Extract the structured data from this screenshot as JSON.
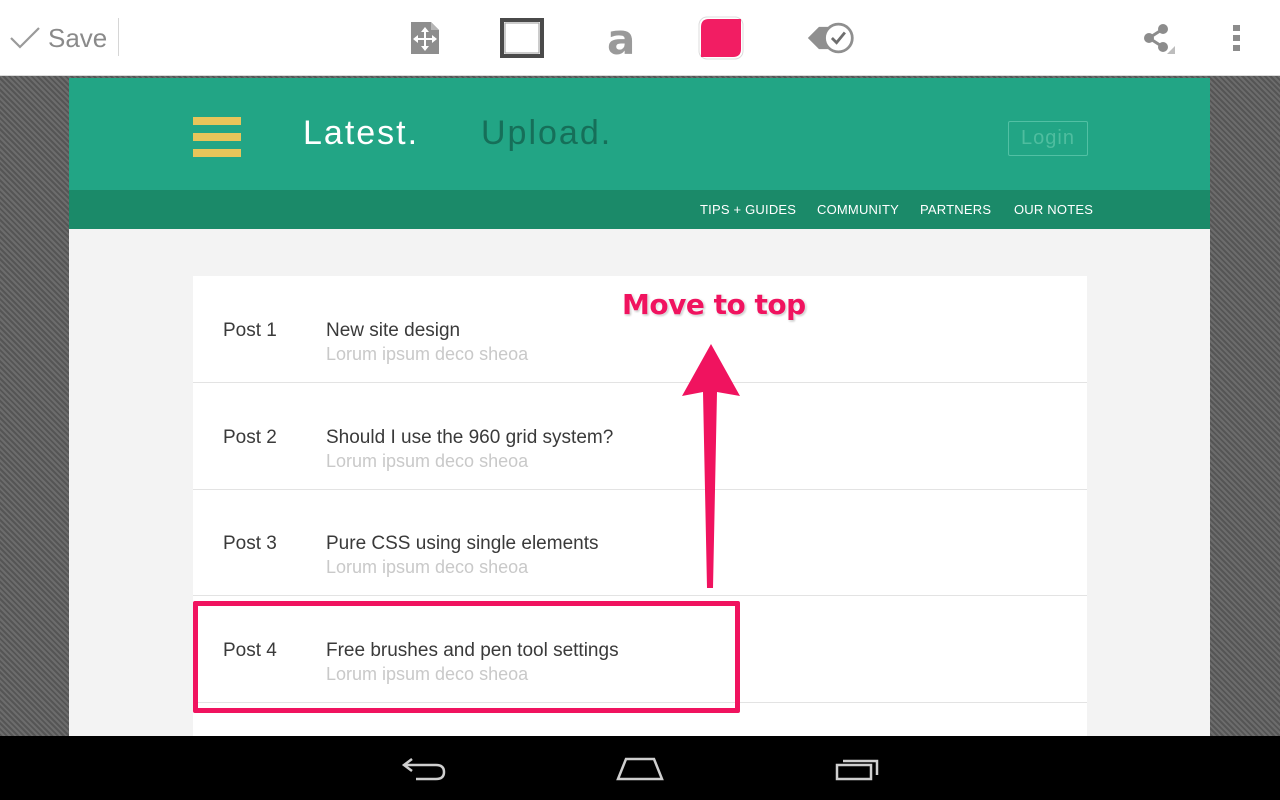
{
  "toolbar": {
    "save_label": "Save",
    "tools": [
      {
        "name": "crop-move-icon"
      },
      {
        "name": "rectangle-icon"
      },
      {
        "name": "text-icon",
        "glyph": "a"
      },
      {
        "name": "color-swatch",
        "color": "#f21d63"
      },
      {
        "name": "tag-check-icon"
      }
    ],
    "accent_color": "#f21d63"
  },
  "site": {
    "nav": {
      "latest": "Latest.",
      "upload": "Upload.",
      "login": "Login"
    },
    "subnav": [
      "TIPS + GUIDES",
      "COMMUNITY",
      "PARTNERS",
      "OUR NOTES"
    ],
    "header_color": "#22a585",
    "subnav_color": "#1b8a69",
    "posts": [
      {
        "num": "Post 1",
        "title": "New site design",
        "subtitle": "Lorum ipsum deco sheoa"
      },
      {
        "num": "Post 2",
        "title": "Should I use the 960 grid system?",
        "subtitle": "Lorum ipsum deco sheoa"
      },
      {
        "num": "Post 3",
        "title": "Pure CSS using single elements",
        "subtitle": "Lorum ipsum deco sheoa"
      },
      {
        "num": "Post 4",
        "title": "Free brushes and pen tool settings",
        "subtitle": "Lorum ipsum deco sheoa"
      }
    ]
  },
  "annotation": {
    "text": "Move to top",
    "color": "#f0135f"
  },
  "system_nav": {
    "buttons": [
      "back-icon",
      "home-icon",
      "recents-icon"
    ]
  }
}
